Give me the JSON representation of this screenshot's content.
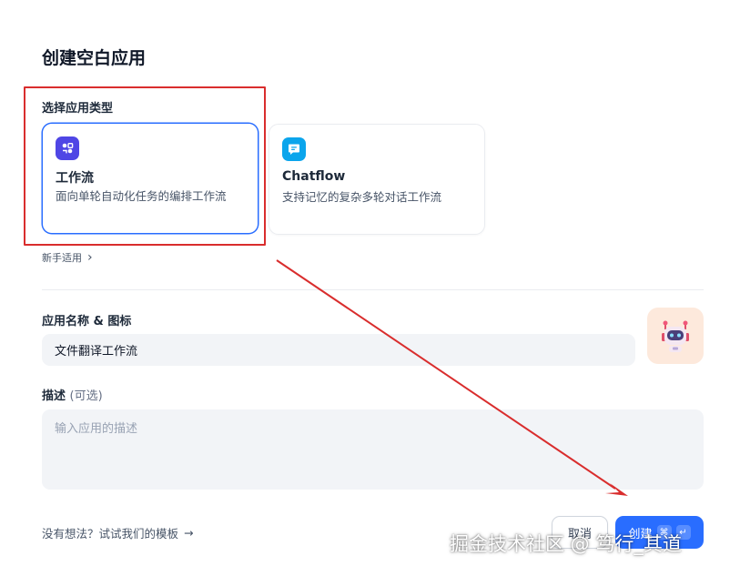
{
  "dialog": {
    "title": "创建空白应用"
  },
  "app_type": {
    "label": "选择应用类型",
    "options": [
      {
        "name": "工作流",
        "description": "面向单轮自动化任务的编排工作流",
        "icon": "workflow-icon",
        "icon_color": "#4f46e5",
        "selected": true
      },
      {
        "name": "Chatflow",
        "description": "支持记忆的复杂多轮对话工作流",
        "icon": "chatflow-icon",
        "icon_color": "#0ba5ec",
        "selected": false
      }
    ],
    "beginner_link": "新手适用"
  },
  "app_name": {
    "label": "应用名称 & 图标",
    "value": "文件翻译工作流",
    "icon": "robot-icon",
    "icon_bg": "#fde9dc"
  },
  "description": {
    "label": "描述",
    "optional": "(可选)",
    "placeholder": "输入应用的描述"
  },
  "footer": {
    "template_link": "没有想法？试试我们的模板",
    "cancel_label": "取消",
    "create_label": "创建",
    "shortcut_cmd": "⌘",
    "shortcut_enter": "↵"
  },
  "watermark": "掘金技术社区 @ 笃行_其道",
  "colors": {
    "primary": "#296dff",
    "annotation_red": "#d92d2d"
  }
}
